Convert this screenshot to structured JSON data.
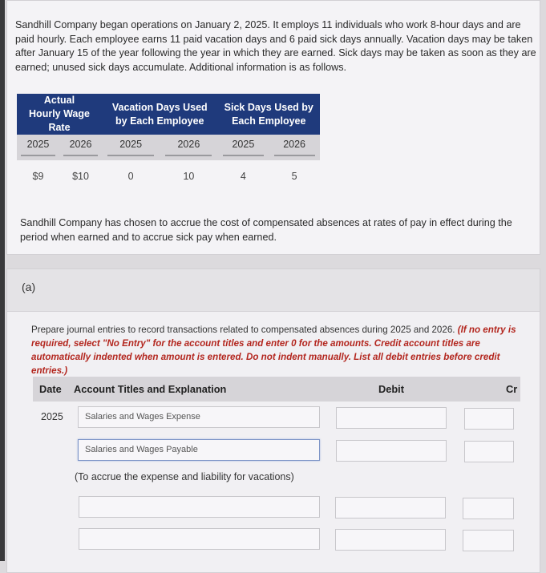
{
  "intro": "Sandhill Company began operations on January 2, 2025. It employs 11 individuals who work 8-hour days and are paid hourly. Each employee earns 11 paid vacation days and 6 paid sick days annually. Vacation days may be taken after January 15 of the year following the year in which they are earned. Sick days may be taken as soon as they are earned; unused sick days accumulate. Additional information is as follows.",
  "table": {
    "headers": [
      "Actual Hourly Wage Rate",
      "Vacation Days Used by Each Employee",
      "Sick Days Used by Each Employee"
    ],
    "years": [
      "2025",
      "2026",
      "2025",
      "2026",
      "2025",
      "2026"
    ],
    "values": [
      "$9",
      "$10",
      "0",
      "10",
      "4",
      "5"
    ]
  },
  "note": "Sandhill Company has chosen to accrue the cost of compensated absences at rates of pay in effect during the period when earned and to accrue sick pay when earned.",
  "part": {
    "label": "(a)",
    "instruction": "Prepare journal entries to record transactions related to compensated absences during 2025 and 2026.",
    "instruction_note": "(If no entry is required, select \"No Entry\" for the account titles and enter 0 for the amounts. Credit account titles are automatically indented when amount is entered. Do not indent manually. List all debit entries before credit entries.)",
    "columns": {
      "date": "Date",
      "account": "Account Titles and Explanation",
      "debit": "Debit",
      "credit": "Cr"
    },
    "entry": {
      "date": "2025",
      "row1_account": "Salaries and Wages Expense",
      "row2_account": "Salaries and Wages Payable",
      "explanation": "(To accrue the expense and liability for vacations)"
    }
  }
}
